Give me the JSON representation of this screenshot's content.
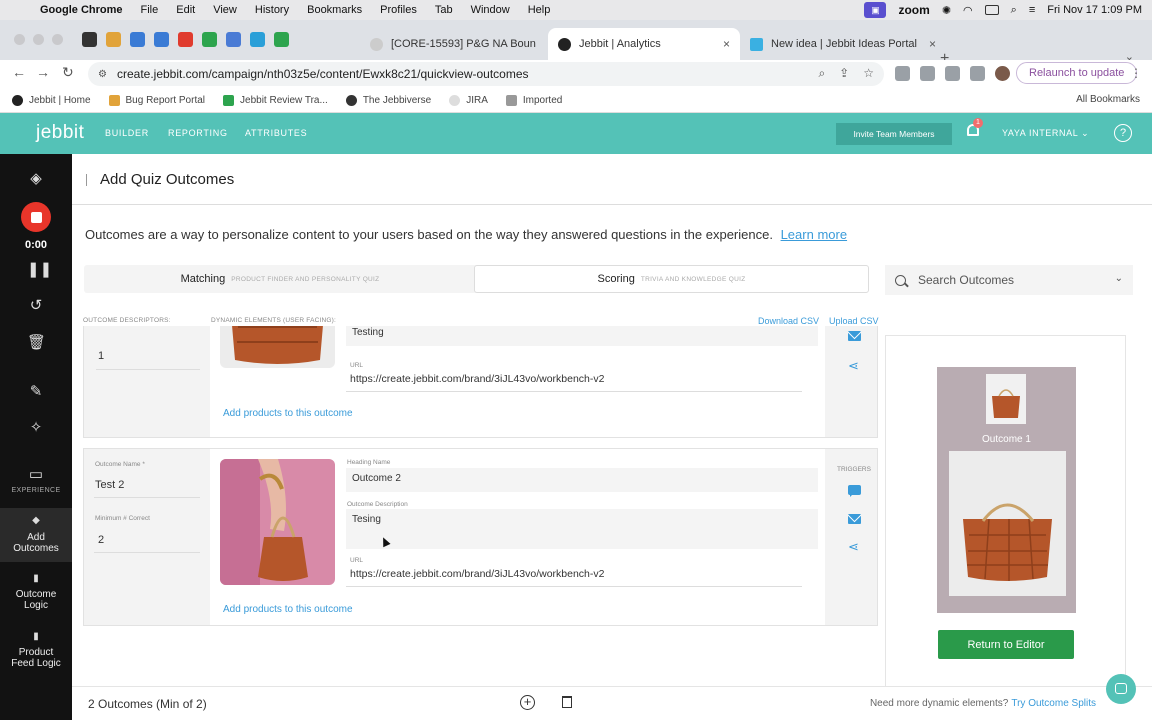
{
  "menubar": {
    "app": "Google Chrome",
    "items": [
      "File",
      "Edit",
      "View",
      "History",
      "Bookmarks",
      "Profiles",
      "Tab",
      "Window",
      "Help"
    ],
    "zoom_label": "zoom",
    "datetime": "Fri Nov 17  1:09 PM"
  },
  "tabs": [
    {
      "title": "[CORE-15593] P&G NA Boun",
      "color": "#cccccc"
    },
    {
      "title": "Jebbit | Analytics",
      "color": "#222222"
    },
    {
      "title": "New idea | Jebbit Ideas Portal",
      "color": "#3ab0e2"
    }
  ],
  "browser": {
    "url": "create.jebbit.com/campaign/nth03z5e/content/Ewxk8c21/quickview-outcomes",
    "relaunch": "Relaunch to update"
  },
  "bookmarks": {
    "items": [
      "Jebbit | Home",
      "Bug Report Portal",
      "Jebbit Review Tra...",
      "The Jebbiverse",
      "JIRA",
      "Imported"
    ],
    "all": "All Bookmarks"
  },
  "header": {
    "logo": "jebbit",
    "nav": [
      "BUILDER",
      "REPORTING",
      "ATTRIBUTES"
    ],
    "invite": "Invite Team Members",
    "notifications": "1",
    "user": "YAYA INTERNAL",
    "help": "?"
  },
  "sidebar": {
    "timer": "0:00",
    "experience": "EXPERIENCE",
    "items": [
      {
        "label": "Add\nOutcomes"
      },
      {
        "label": "Outcome\nLogic"
      },
      {
        "label": "Product\nFeed Logic"
      }
    ]
  },
  "page": {
    "title": "Add Quiz Outcomes",
    "intro": "Outcomes are a way to personalize content to your users based on the way they answered questions in the experience.",
    "learn_more": "Learn more"
  },
  "modes": [
    {
      "label": "Matching",
      "sub": "PRODUCT FINDER AND PERSONALITY QUIZ"
    },
    {
      "label": "Scoring",
      "sub": "TRIVIA AND KNOWLEDGE QUIZ"
    }
  ],
  "search": {
    "placeholder": "Search Outcomes"
  },
  "columns": {
    "descriptors": "OUTCOME DESCRIPTORS:",
    "dynamic": "DYNAMIC ELEMENTS (USER FACING):",
    "download_csv": "Download CSV",
    "upload_csv": "Upload CSV"
  },
  "outcome1": {
    "min_correct": "1",
    "description": "Testing",
    "url_label": "URL",
    "url": "https://create.jebbit.com/brand/3iJL43vo/workbench-v2",
    "add_products": "Add products to this outcome"
  },
  "outcome2": {
    "name_label": "Outcome Name *",
    "name": "Test 2",
    "min_label": "Minimum # Correct",
    "min_correct": "2",
    "heading_label": "Heading Name",
    "heading": "Outcome 2",
    "desc_label": "Outcome Description",
    "description": "Tesing",
    "url_label": "URL",
    "url": "https://create.jebbit.com/brand/3iJL43vo/workbench-v2",
    "add_products": "Add products to this outcome",
    "triggers": "TRIGGERS"
  },
  "preview": {
    "title": "Outcome 1",
    "return": "Return to Editor"
  },
  "footer": {
    "count": "2 Outcomes (Min of 2)",
    "more": "Need more dynamic elements?",
    "more_link": "Try Outcome Splits"
  },
  "colors": {
    "brand": "#54c2b7",
    "link": "#3a9bd9",
    "return": "#2a9a4a",
    "record": "#e8352a"
  }
}
